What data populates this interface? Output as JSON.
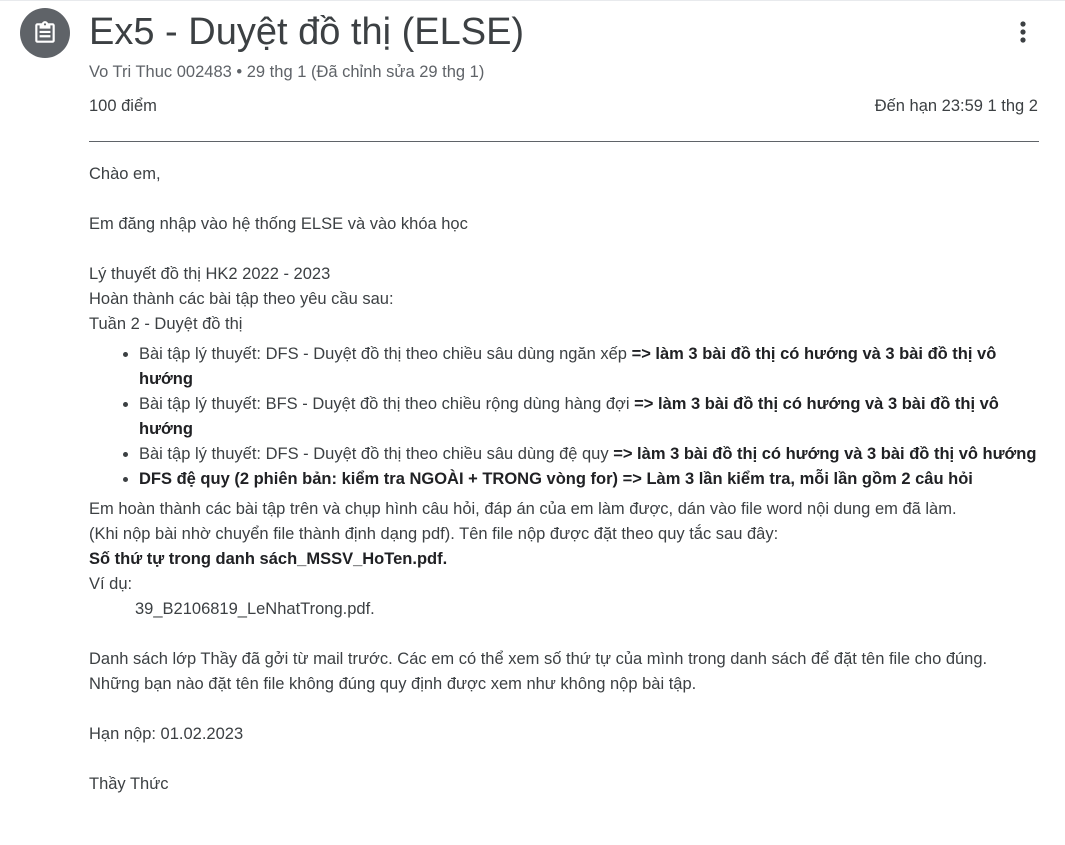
{
  "header": {
    "title": "Ex5 - Duyệt đồ thị (ELSE)",
    "meta": "Vo Tri Thuc 002483 • 29 thg 1 (Đã chỉnh sửa 29 thg 1)",
    "points": "100 điểm",
    "due": "Đến hạn 23:59 1 thg 2",
    "icon": "assignment-icon",
    "menu_icon": "more-vert-icon"
  },
  "body": {
    "greeting": "Chào em,",
    "intro": "Em đăng nhập vào hệ thống ELSE và vào khóa học",
    "course": "Lý thuyết đồ thị HK2 2022 - 2023",
    "instructions": "Hoàn thành các bài tập theo yêu cầu sau:",
    "week": "Tuần 2 - Duyệt đồ thị",
    "tasks": [
      {
        "text": "Bài tập lý thuyết: DFS - Duyệt đồ thị theo chiều sâu dùng ngăn xếp ",
        "bold": "=> làm 3 bài đồ thị có hướng và 3 bài đồ thị vô hướng"
      },
      {
        "text": "Bài tập lý thuyết: BFS - Duyệt đồ thị theo chiều rộng dùng hàng đợi ",
        "bold": "=> làm 3 bài đồ thị có hướng và 3 bài đồ thị vô hướng"
      },
      {
        "text": "Bài tập lý thuyết: DFS - Duyệt đồ thị theo chiều sâu dùng đệ quy ",
        "bold": "=> làm 3 bài đồ thị có hướng và 3 bài đồ thị vô hướng"
      },
      {
        "text": "",
        "bold": "DFS đệ quy (2 phiên bản: kiểm tra NGOÀI + TRONG vòng for) => Làm 3 lần kiểm tra, mỗi lần gồm 2 câu hỏi"
      }
    ],
    "submit_line1": "Em hoàn thành các bài tập trên và chụp hình câu hỏi, đáp án của em làm được, dán vào file word nội dung em đã làm.",
    "submit_line2": "(Khi nộp bài nhờ chuyển file thành định dạng pdf). Tên file nộp được đặt theo quy tắc sau đây:",
    "filename_rule": "Số thứ tự trong danh sách_MSSV_HoTen.pdf.",
    "example_label": "Ví dụ:",
    "example_value": "39_B2106819_LeNhatTrong.pdf.",
    "class_list": "Danh sách lớp Thầy đã gởi từ mail trước. Các em có thể xem số thứ tự của mình trong danh sách để đặt tên file cho đúng. Những bạn nào đặt tên file không đúng quy định được xem như không nộp bài tập.",
    "deadline": "Hạn nộp: 01.02.2023",
    "signature": "Thầy Thức"
  }
}
